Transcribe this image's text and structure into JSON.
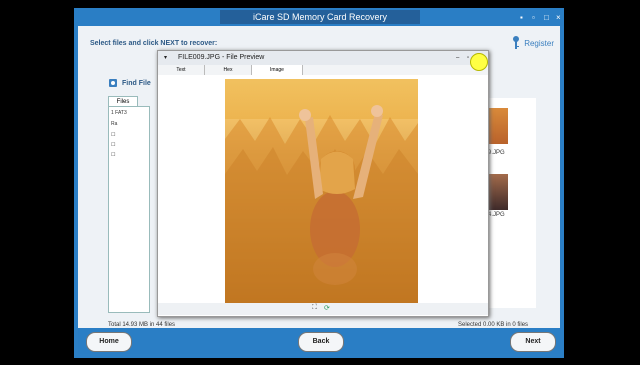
{
  "app": {
    "title": "iCare SD Memory Card Recovery",
    "prompt": "Select files and click NEXT to recover:",
    "register_label": "Register",
    "find_file_label": "Find File",
    "files_tab": "Files",
    "tree": [
      "1 FAT3",
      "Ra"
    ],
    "status_left": "Total 14.93 MB in 44 files",
    "status_right": "Selected 0.00 KB in 0 files",
    "buttons": {
      "home": "Home",
      "back": "Back",
      "next": "Next"
    },
    "thumbs": [
      {
        "label": "9.JPG"
      },
      {
        "label": "4.JPG"
      }
    ]
  },
  "preview": {
    "title": "FILE009.JPG - File Preview",
    "tabs": [
      "Text",
      "Hex",
      "Image"
    ]
  },
  "colors": {
    "accent": "#2a7ec5",
    "title_dark": "#24609a",
    "highlight": "#ffff44"
  }
}
